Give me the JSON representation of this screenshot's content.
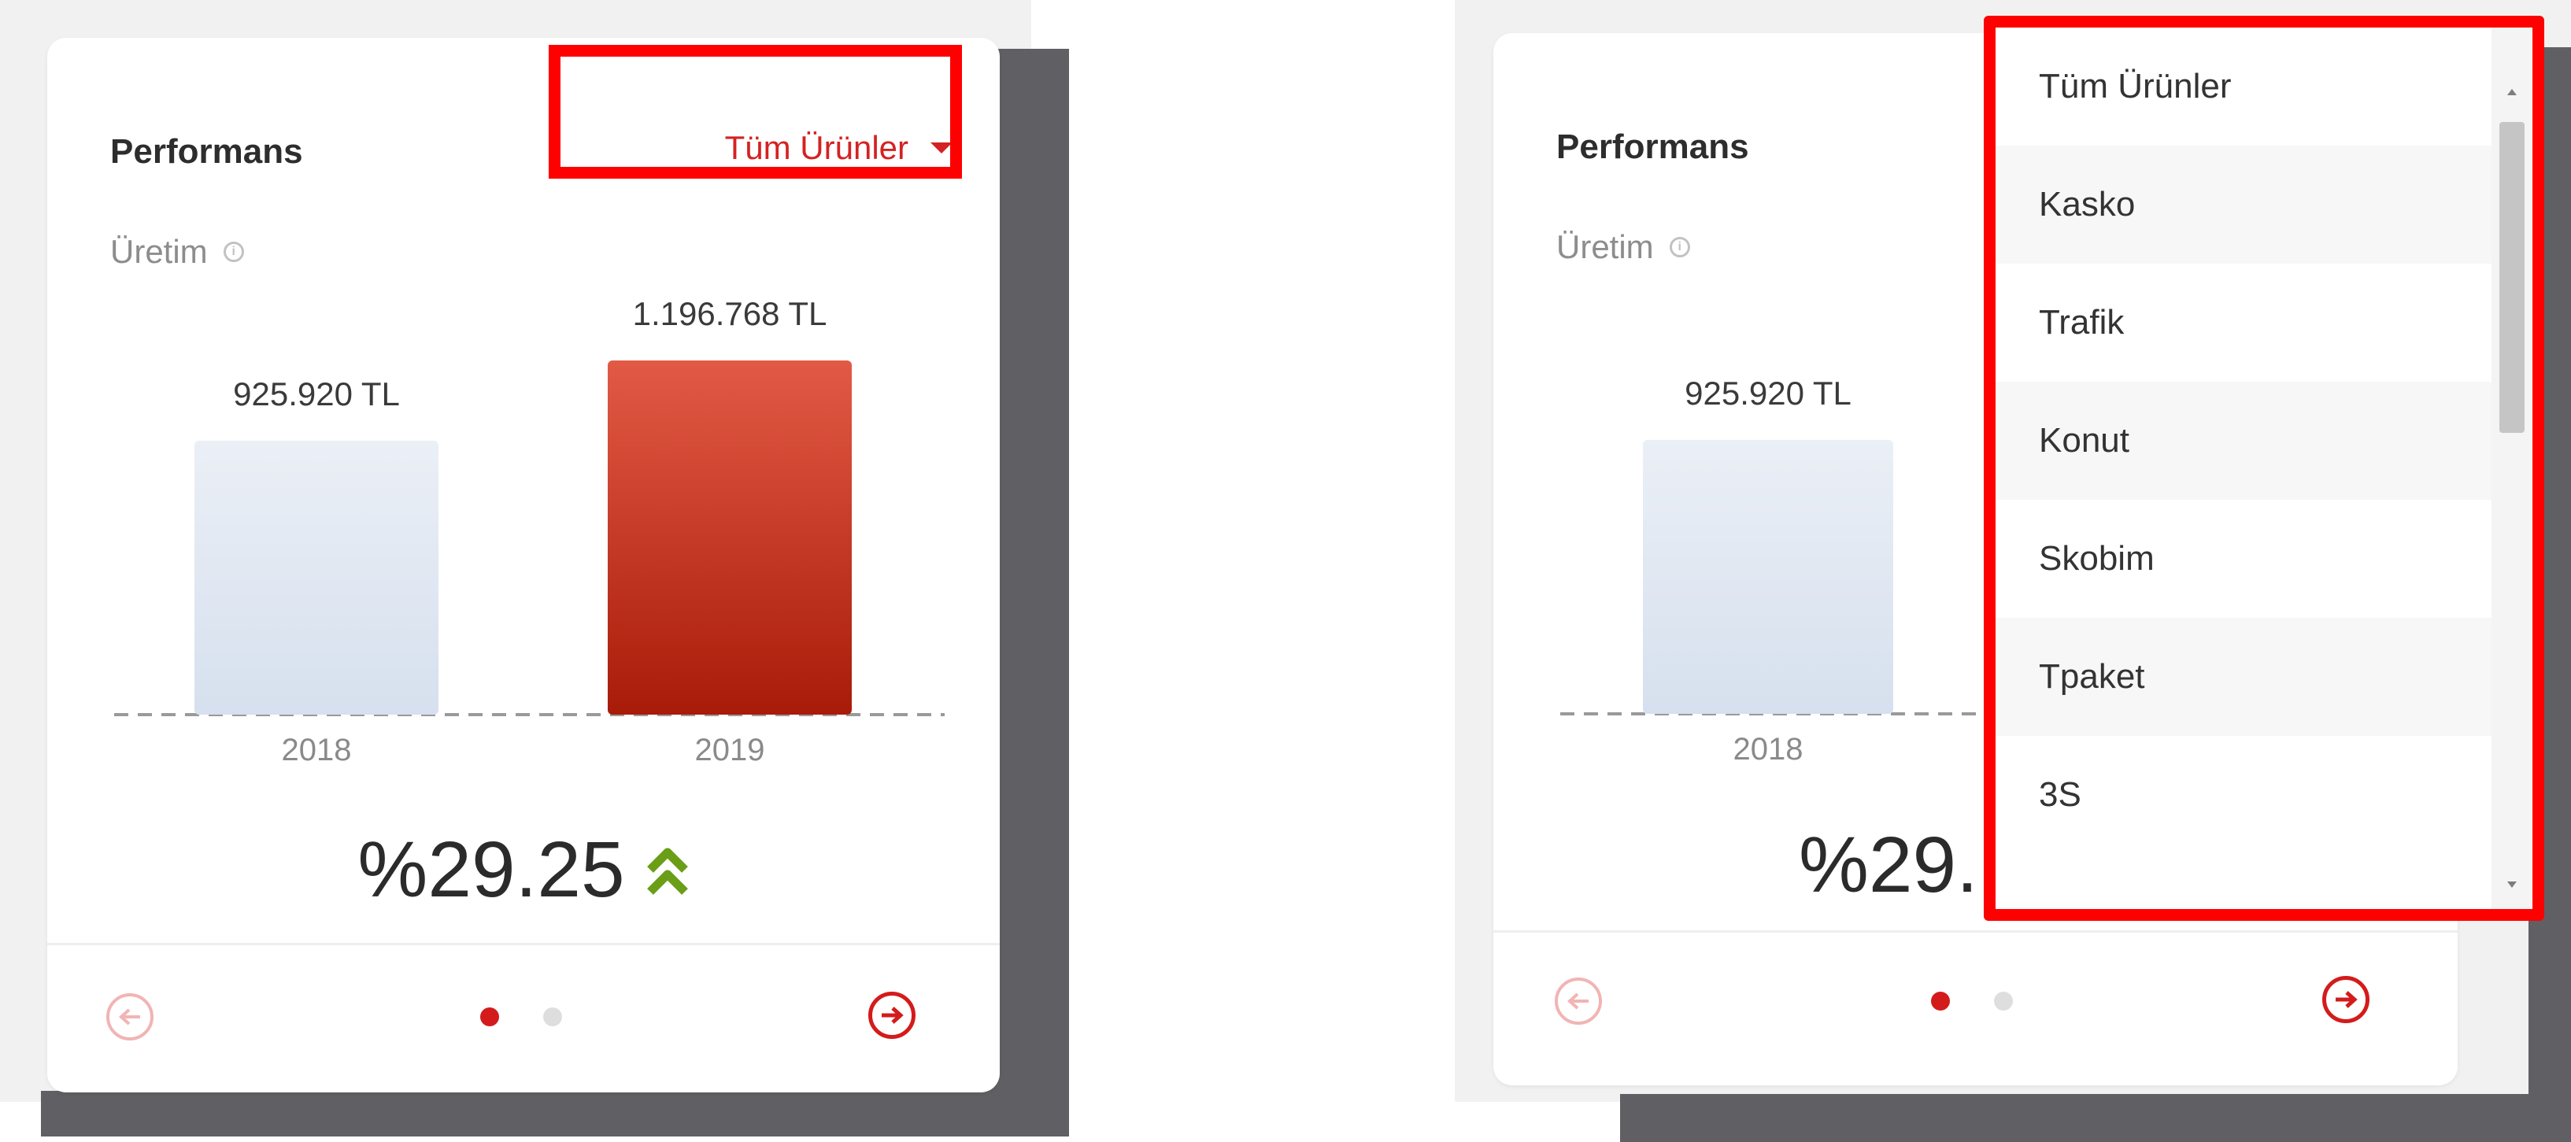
{
  "panel_left": {
    "title": "Performans",
    "filter_label": "Tüm Ürünler",
    "subtitle": "Üretim",
    "percent_change": "%29.25",
    "pagination": {
      "active_index": 0,
      "count": 2
    }
  },
  "panel_right": {
    "title": "Performans",
    "subtitle": "Üretim",
    "percent_change_visible": "%29.",
    "pagination": {
      "active_index": 0,
      "count": 2
    },
    "dropdown_options": [
      "Tüm Ürünler",
      "Kasko",
      "Trafik",
      "Konut",
      "Skobim",
      "Tpaket",
      "3S"
    ]
  },
  "chart_data": [
    {
      "type": "bar",
      "categories": [
        "2018",
        "2019"
      ],
      "values": [
        925920,
        1196768
      ],
      "value_labels": [
        "925.920 TL",
        "1.196.768 TL"
      ],
      "colors": [
        "#dfe6f0",
        "#c9321f"
      ]
    },
    {
      "type": "bar",
      "categories": [
        "2018"
      ],
      "values": [
        925920
      ],
      "value_labels": [
        "925.920 TL"
      ],
      "colors": [
        "#dfe6f0"
      ]
    }
  ],
  "colors": {
    "accent": "#d42222",
    "highlight_box": "#ff0000",
    "trend_up": "#6a9e17",
    "bar_previous": "#dfe6f0",
    "bar_current": "#c9321f",
    "shadow": "#606064",
    "backdrop": "#f1f1f1"
  },
  "icons": {
    "info": "info-circle-icon",
    "trend": "double-chevron-up-icon",
    "prev": "arrow-left-circle-icon",
    "next": "arrow-right-circle-icon",
    "filter_caret": "caret-down-icon"
  }
}
